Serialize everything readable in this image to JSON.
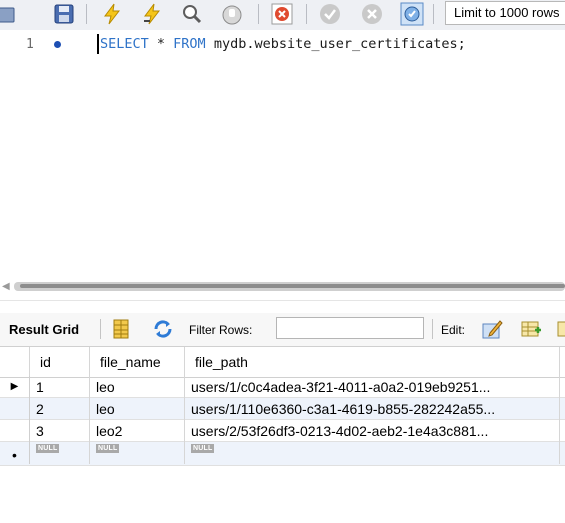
{
  "toolbar": {
    "icons": [
      "open-folder-icon",
      "save-icon",
      "execute-icon",
      "execute-current-icon",
      "explain-icon",
      "stop-icon",
      "toggle-error-icon",
      "commit-icon",
      "rollback-icon",
      "autocommit-icon"
    ],
    "limit_label": "Limit to 1000 rows"
  },
  "editor": {
    "line_number": "1",
    "sql": {
      "kw1": "SELECT",
      "star": " * ",
      "kw2": "FROM",
      "rest": " mydb.website_user_certificates;"
    }
  },
  "result_toolbar": {
    "result_grid_label": "Result Grid",
    "filter_label": "Filter Rows:",
    "filter_value": "",
    "edit_label": "Edit:"
  },
  "grid": {
    "columns": [
      "id",
      "file_name",
      "file_path"
    ],
    "rows": [
      {
        "id": "1",
        "file_name": "leo",
        "file_path": "users/1/c0c4adea-3f21-4011-a0a2-019eb9251..."
      },
      {
        "id": "2",
        "file_name": "leo",
        "file_path": "users/1/110e6360-c3a1-4619-b855-282242a55..."
      },
      {
        "id": "3",
        "file_name": "leo2",
        "file_path": "users/2/53f26df3-0213-4d02-aeb2-1e4a3c881..."
      }
    ],
    "new_row": {
      "id": "NULL",
      "file_name": "NULL",
      "file_path": "NULL"
    }
  },
  "colors": {
    "keyword": "#2f73c8",
    "alt_row": "#eef3fb",
    "toolbar_bg": "#eef0f4"
  }
}
